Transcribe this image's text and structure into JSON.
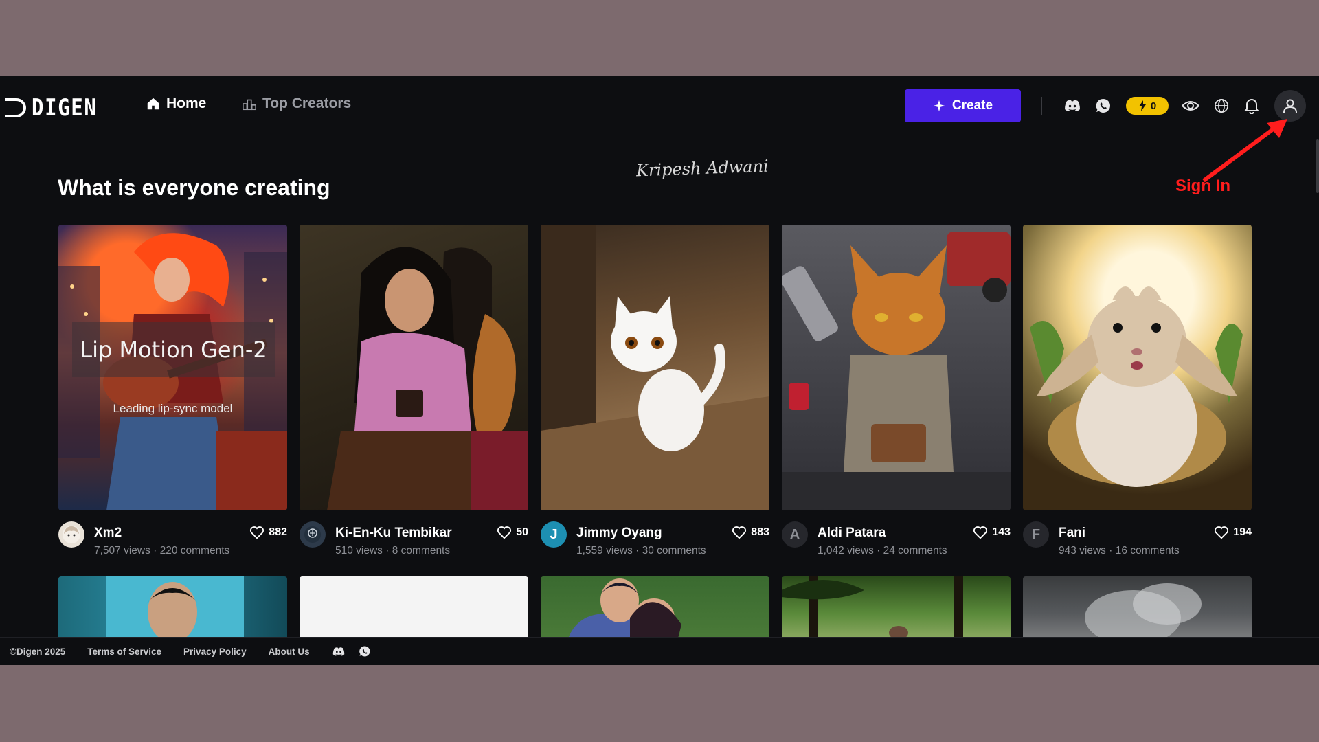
{
  "brand": {
    "name": "DIGEN"
  },
  "nav": {
    "home": "Home",
    "top_creators": "Top Creators",
    "create": "Create",
    "credits": "0"
  },
  "annotation": {
    "signature": "Kripesh Adwani",
    "sign_in": "Sign In"
  },
  "section": {
    "title": "What is everyone creating"
  },
  "feature_overlay": {
    "title": "Lip Motion Gen-2",
    "subtitle": "Leading lip-sync model"
  },
  "cards": [
    {
      "name": "Xm2",
      "stats": "7,507 views · 220 comments",
      "likes": "882",
      "initial": "",
      "avatar_color": "#e9e2d8"
    },
    {
      "name": "Ki-En-Ku Tembikar",
      "stats": "510 views · 8 comments",
      "likes": "50",
      "initial": "",
      "avatar_color": "#2d3a4a"
    },
    {
      "name": "Jimmy Oyang",
      "stats": "1,559 views · 30 comments",
      "likes": "883",
      "initial": "J",
      "avatar_color": "#1d8fb2"
    },
    {
      "name": "Aldi Patara",
      "stats": "1,042 views · 24 comments",
      "likes": "143",
      "initial": "A",
      "avatar_color": "#26272c"
    },
    {
      "name": "Fani",
      "stats": "943 views · 16 comments",
      "likes": "194",
      "initial": "F",
      "avatar_color": "#26272c"
    }
  ],
  "footer": {
    "copyright": "©Digen 2025",
    "terms": "Terms of Service",
    "privacy": "Privacy Policy",
    "about": "About Us"
  },
  "colors": {
    "accent": "#4a22e6",
    "credits": "#f2c200",
    "annotation": "#ff1d1d"
  }
}
